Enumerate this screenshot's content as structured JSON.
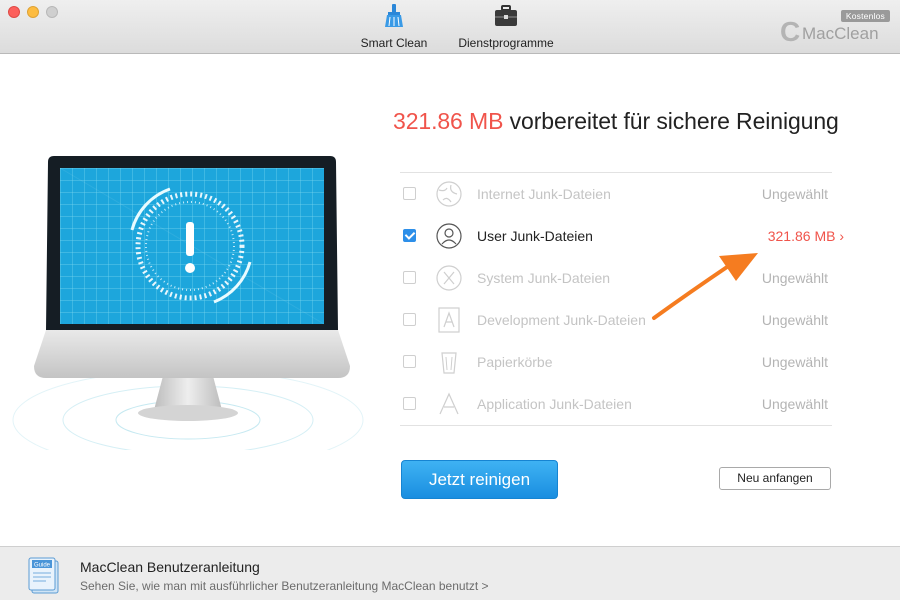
{
  "toolbar": {
    "tools": [
      {
        "label": "Smart Clean",
        "icon": "broom-icon"
      },
      {
        "label": "Dienstprogramme",
        "icon": "toolbox-icon"
      }
    ],
    "brand": {
      "badge": "Kostenlos",
      "letter": "C",
      "name": "MacClean"
    }
  },
  "main": {
    "headline_amount": "321.86 MB",
    "headline_text": " vorbereitet für sichere Reinigung",
    "items": [
      {
        "label": "Internet Junk-Dateien",
        "status": "Ungewählt",
        "checked": false,
        "icon": "globe-icon"
      },
      {
        "label": "User Junk-Dateien",
        "status": "321.86 MB ›",
        "checked": true,
        "icon": "user-icon"
      },
      {
        "label": "System Junk-Dateien",
        "status": "Ungewählt",
        "checked": false,
        "icon": "system-x-icon"
      },
      {
        "label": "Development Junk-Dateien",
        "status": "Ungewählt",
        "checked": false,
        "icon": "xcode-icon"
      },
      {
        "label": "Papierkörbe",
        "status": "Ungewählt",
        "checked": false,
        "icon": "trash-icon"
      },
      {
        "label": "Application Junk-Dateien",
        "status": "Ungewählt",
        "checked": false,
        "icon": "app-store-icon"
      }
    ],
    "clean_button": "Jetzt reinigen",
    "restart_button": "Neu anfangen"
  },
  "footer": {
    "guide_icon_label": "Guide",
    "title": "MacClean Benutzeranleitung",
    "subtitle": "Sehen Sie, wie man mit ausführlicher Benutzeranleitung MacClean benutzt >"
  },
  "colors": {
    "accent": "#f0544b",
    "blue": "#1a8ee0",
    "arrow": "#f57c20"
  }
}
